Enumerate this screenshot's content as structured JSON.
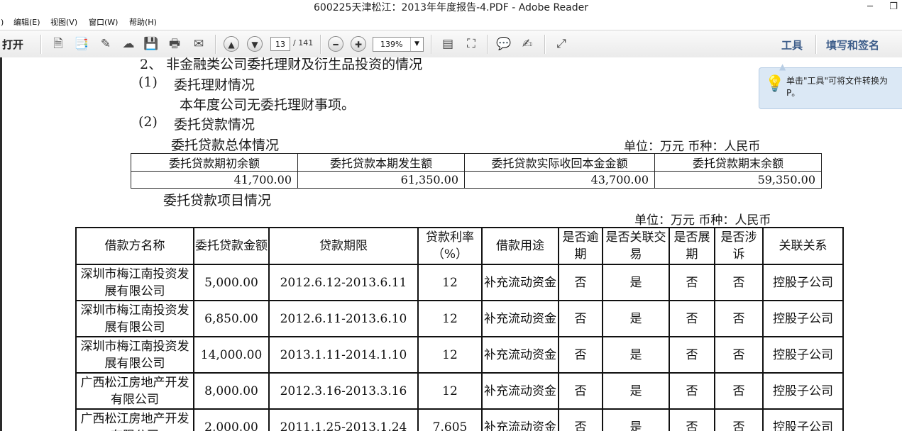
{
  "window": {
    "title": "600225天津松江：2013年年度报告-4.PDF - Adobe Reader"
  },
  "menu": {
    "items": [
      ")",
      "编辑(E)",
      "视图(V)",
      "窗口(W)",
      "帮助(H)"
    ]
  },
  "toolbar": {
    "open_label": "打开",
    "page_current": "13",
    "page_total": "/ 141",
    "zoom": "139%",
    "tools_label": "工具",
    "fill_sign_label": "填写和签名"
  },
  "tooltip": {
    "text": "单击\"工具\"可将文件转换为 P。"
  },
  "doc": {
    "heading_2": "2、    非金融类公司委托理财及衍生品投资的情况",
    "sub1_num": "(1)",
    "sub1_title": "委托理财情况",
    "sub1_text": "本年度公司无委托理财事项。",
    "sub2_num": "(2)",
    "sub2_title": "委托贷款情况",
    "summary_title": "委托贷款总体情况",
    "summary_unit": "单位：万元  币种：人民币",
    "summary_headers": [
      "委托贷款期初余额",
      "委托贷款本期发生额",
      "委托贷款实际收回本金金额",
      "委托贷款期末余额"
    ],
    "summary_values": [
      "41,700.00",
      "61,350.00",
      "43,700.00",
      "59,350.00"
    ],
    "project_title": "委托贷款项目情况",
    "project_unit": "单位：万元  币种：人民币",
    "project_headers": [
      "借款方名称",
      "委托贷款金额",
      "贷款期限",
      "贷款利率（%）",
      "借款用途",
      "是否逾期",
      "是否关联交易",
      "是否展期",
      "是否涉诉",
      "关联关系"
    ],
    "project_rows": [
      [
        "深圳市梅江南投资发展有限公司",
        "5,000.00",
        "2012.6.12-2013.6.11",
        "12",
        "补充流动资金",
        "否",
        "是",
        "否",
        "否",
        "控股子公司"
      ],
      [
        "深圳市梅江南投资发展有限公司",
        "6,850.00",
        "2012.6.11-2013.6.10",
        "12",
        "补充流动资金",
        "否",
        "是",
        "否",
        "否",
        "控股子公司"
      ],
      [
        "深圳市梅江南投资发展有限公司",
        "14,000.00",
        "2013.1.11-2014.1.10",
        "12",
        "补充流动资金",
        "否",
        "是",
        "否",
        "否",
        "控股子公司"
      ],
      [
        "广西松江房地产开发有限公司",
        "8,000.00",
        "2012.3.16-2013.3.16",
        "12",
        "补充流动资金",
        "否",
        "是",
        "否",
        "否",
        "控股子公司"
      ],
      [
        "广西松江房地产开发有限公司",
        "2,000.00",
        "2011.1.25-2013.1.24",
        "7.605",
        "补充流动资金",
        "否",
        "是",
        "否",
        "否",
        "控股子公司"
      ]
    ]
  }
}
